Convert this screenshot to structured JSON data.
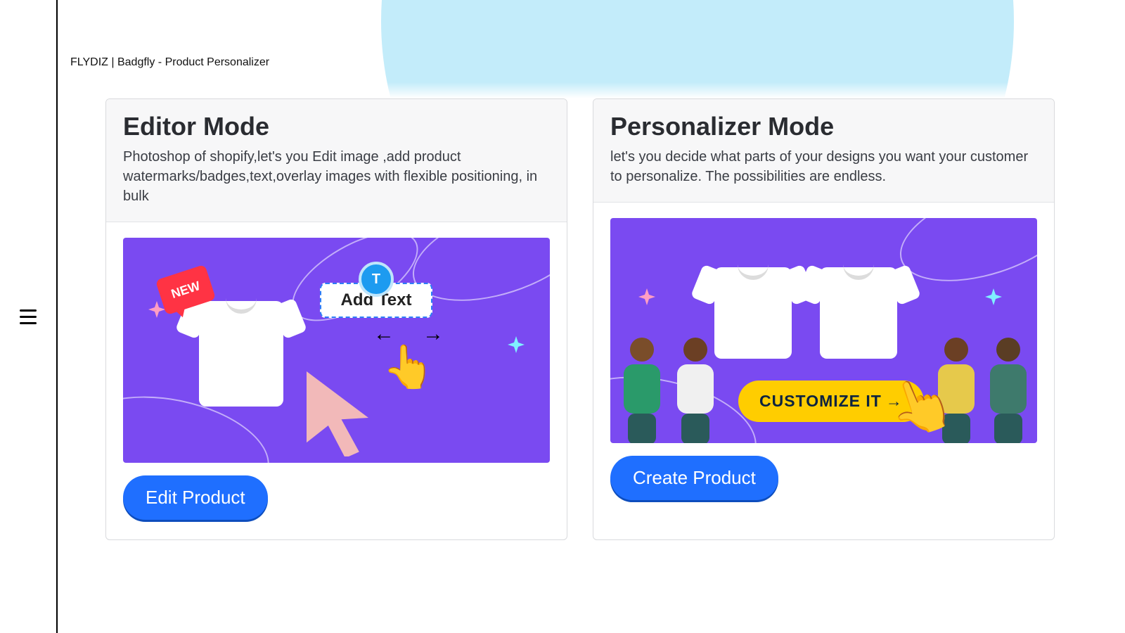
{
  "page": {
    "title": "FLYDIZ | Badgfly - Product Personalizer"
  },
  "cards": {
    "editor": {
      "title": "Editor Mode",
      "description": "Photoshop of shopify,let's you Edit image ,add product watermarks/badges,text,overlay images with flexible positioning, in bulk",
      "illustration": {
        "badge_text": "NEW",
        "addtext_label": "Add Text",
        "t_icon": "T"
      },
      "cta_label": "Edit Product"
    },
    "personalizer": {
      "title": "Personalizer Mode",
      "description": "let's you decide what parts of your designs you want your customer to personalize. The possibilities are endless.",
      "illustration": {
        "customize_label": "CUSTOMIZE IT"
      },
      "cta_label": "Create Product"
    }
  },
  "colors": {
    "accent_blue": "#1f6fff",
    "illus_purple": "#7a4af1",
    "bg_circle": "#c3ecfa",
    "customize_yellow": "#ffcd00",
    "new_badge_red": "#ff3344"
  }
}
